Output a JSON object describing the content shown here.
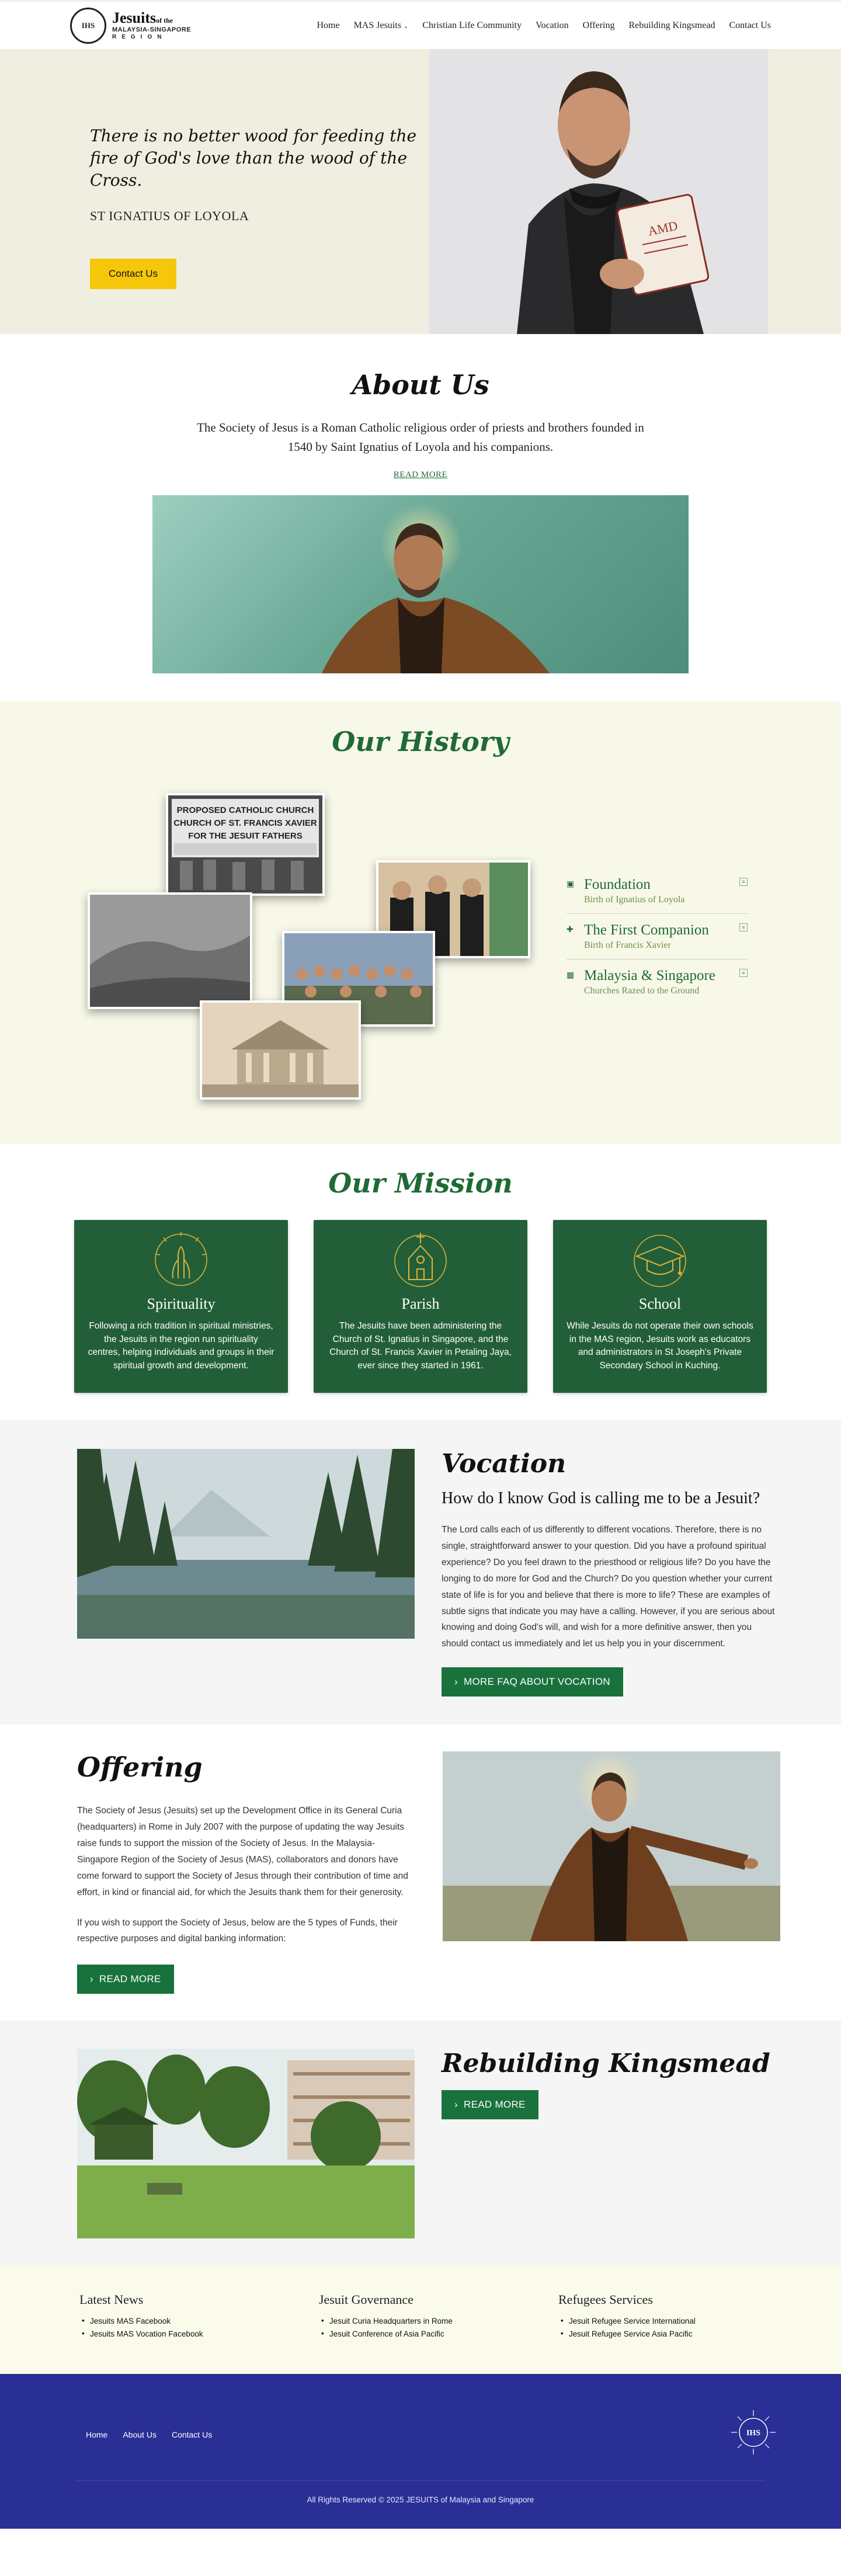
{
  "header": {
    "logo_title": "Jesuits",
    "logo_of": "of the",
    "logo_region_name": "MALAYSIA-SINGAPORE",
    "logo_region": "REGION",
    "logo_seal": "IHS",
    "nav": [
      "Home",
      "MAS Jesuits",
      "Christian Life Community",
      "Vocation",
      "Offering",
      "Rebuilding Kingsmead",
      "Contact Us"
    ]
  },
  "hero": {
    "quote": "There is no better wood for feeding the fire of God's love than the wood of the Cross.",
    "author": "ST IGNATIUS OF LOYOLA",
    "cta": "Contact Us"
  },
  "about": {
    "title": "About Us",
    "text": "The Society of Jesus is a Roman Catholic religious order of priests and brothers founded in 1540 by Saint Ignatius of Loyola and his companions.",
    "link": "READ MORE"
  },
  "history": {
    "title": "Our History",
    "sign_lines": [
      "PROPOSED CATHOLIC CHURCH",
      "CHURCH OF ST. FRANCIS XAVIER",
      "FOR THE JESUIT FATHERS"
    ],
    "items": [
      {
        "title": "Foundation",
        "sub": "Birth of Ignatius of Loyola"
      },
      {
        "title": "The First Companion",
        "sub": "Birth of Francis Xavier"
      },
      {
        "title": "Malaysia & Singapore",
        "sub": "Churches Razed to the Ground"
      }
    ]
  },
  "mission": {
    "title": "Our Mission",
    "cards": [
      {
        "title": "Spirituality",
        "text": "Following a rich tradition in spiritual ministries, the Jesuits in the region run spirituality centres, helping individuals and groups in their spiritual growth and development.",
        "icon": "praying-hands-icon"
      },
      {
        "title": "Parish",
        "text": "The Jesuits have been administering the Church of St. Ignatius in Singapore, and the Church of St. Francis Xavier in Petaling Jaya, ever since they started in 1961.",
        "icon": "church-icon"
      },
      {
        "title": "School",
        "text": "While Jesuits do not operate their own schools in the MAS region, Jesuits work as educators and administrators in St Joseph's Private Secondary School in Kuching.",
        "icon": "graduation-cap-icon"
      }
    ]
  },
  "vocation": {
    "title": "Vocation",
    "question": "How do I know God is calling me to be a Jesuit?",
    "text": "The Lord calls each of us differently to different vocations. Therefore, there is no single, straightforward answer to your question. Did you have a profound spiritual experience? Do you feel drawn to the priesthood or religious life? Do you have the longing to do more for God and the Church? Do you question whether your current state of life is for you and believe that there is more to life? These are examples of subtle signs that indicate you may have a calling. However, if you are serious about knowing and doing God's will, and wish for a more definitive answer, then you should contact us immediately and let us help you in your discernment.",
    "button": "MORE FAQ ABOUT VOCATION"
  },
  "offering": {
    "title": "Offering",
    "text1": "The Society of Jesus (Jesuits) set up the Development Office in its General Curia (headquarters) in Rome in July 2007 with the purpose of updating the way Jesuits raise funds to support the mission of the Society of Jesus. In the Malaysia-Singapore Region of the Society of Jesus (MAS), collaborators and donors have come forward to support the Society of Jesus through their contribution of time and effort, in kind or financial aid, for which the Jesuits thank them for their generosity.",
    "text2": "If you wish to support the Society of Jesus, below are the 5 types of Funds, their respective purposes and digital banking information:",
    "button": "READ MORE"
  },
  "kingsmead": {
    "title": "Rebuilding Kingsmead",
    "button": "READ MORE"
  },
  "links": [
    {
      "title": "Latest News",
      "items": [
        "Jesuits MAS Facebook",
        "Jesuits MAS Vocation Facebook"
      ]
    },
    {
      "title": "Jesuit Governance",
      "items": [
        "Jesuit Curia Headquarters in Rome",
        "Jesuit Conference of Asia Pacific"
      ]
    },
    {
      "title": "Refugees Services",
      "items": [
        "Jesuit Refugee Service International",
        "Jesuit Refugee Service Asia Pacific"
      ]
    }
  ],
  "footer": {
    "nav": [
      "Home",
      "About Us",
      "Contact Us"
    ],
    "seal": "IHS",
    "copyright": "All Rights Reserved © 2025 JESUITS of Malaysia and Singapore"
  },
  "colors": {
    "green": "#225f38",
    "button_green": "#19723c",
    "yellow": "#f5c60a",
    "footer_blue": "#2a2f96",
    "hero_bg": "#efeee0",
    "history_bg": "#f8f8e9"
  }
}
